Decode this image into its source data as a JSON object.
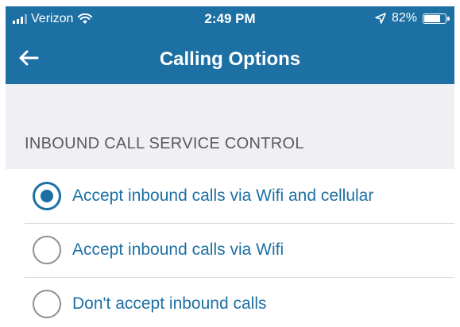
{
  "status_bar": {
    "carrier": "Verizon",
    "time": "2:49 PM",
    "battery": "82%",
    "battery_level": 0.82,
    "icons": [
      "signal-icon",
      "wifi-icon",
      "location-arrow-icon",
      "battery-icon"
    ]
  },
  "header": {
    "title": "Calling Options",
    "back_icon": "back-arrow-icon"
  },
  "section": {
    "title": "INBOUND CALL SERVICE CONTROL",
    "options": [
      {
        "label": "Accept inbound calls via Wifi and cellular",
        "selected": true
      },
      {
        "label": "Accept inbound calls via Wifi",
        "selected": false
      },
      {
        "label": "Don't accept inbound calls",
        "selected": false
      }
    ]
  },
  "colors": {
    "brand": "#1d70a4",
    "background": "#efeff4",
    "section_header_text": "#5a5a5f",
    "unselected_radio": "#8e8e93"
  }
}
